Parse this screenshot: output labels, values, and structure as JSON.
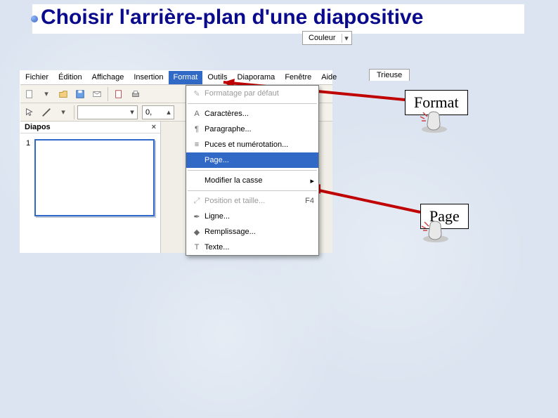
{
  "title": "Choisir l'arrière-plan d'une diapositive",
  "menubar": {
    "items": [
      "Fichier",
      "Édition",
      "Affichage",
      "Insertion",
      "Format",
      "Outils",
      "Diaporama",
      "Fenêtre",
      "Aide"
    ],
    "active": "Format"
  },
  "toolbar2": {
    "zoom_value": "0,"
  },
  "slides_panel": {
    "title": "Diapos",
    "close": "×",
    "first_num": "1"
  },
  "format_menu": {
    "items": [
      {
        "label": "Formatage par défaut",
        "disabled": true
      },
      {
        "sep": true
      },
      {
        "label": "Caractères...",
        "icon": "char"
      },
      {
        "label": "Paragraphe...",
        "icon": "para"
      },
      {
        "label": "Puces et numérotation...",
        "icon": "bullets"
      },
      {
        "label": "Page...",
        "selected": true
      },
      {
        "sep": true
      },
      {
        "label": "Modifier la casse",
        "arrow": true
      },
      {
        "sep": true
      },
      {
        "label": "Position et taille...",
        "shortcut": "F4",
        "icon": "pos",
        "disabled": true
      },
      {
        "label": "Ligne...",
        "icon": "line"
      },
      {
        "label": "Remplissage...",
        "icon": "fill"
      },
      {
        "label": "Texte...",
        "icon": "text"
      }
    ]
  },
  "couleur_label": "Couleur",
  "right_tab": "Trieuse",
  "callouts": {
    "format": "Format",
    "page": "Page"
  }
}
